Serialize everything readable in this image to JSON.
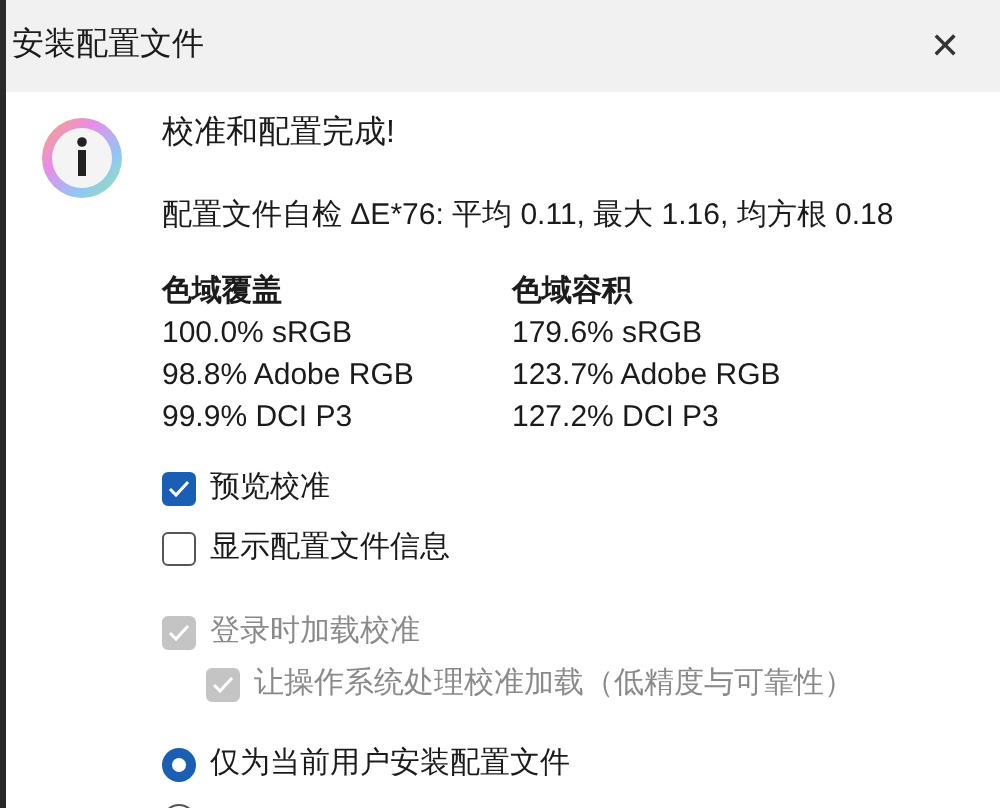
{
  "window": {
    "title": "安装配置文件",
    "close": "✕"
  },
  "heading": "校准和配置完成!",
  "self_check": "配置文件自检 ΔE*76: 平均 0.11, 最大 1.16, 均方根 0.18",
  "gamut_columns": [
    {
      "title": "色域覆盖",
      "rows": [
        "100.0% sRGB",
        "98.8% Adobe RGB",
        "99.9% DCI P3"
      ]
    },
    {
      "title": "色域容积",
      "rows": [
        "179.6% sRGB",
        "123.7% Adobe RGB",
        "127.2% DCI P3"
      ]
    }
  ],
  "checkboxes": [
    {
      "label": "预览校准",
      "checked": true,
      "disabled": false
    },
    {
      "label": "显示配置文件信息",
      "checked": false,
      "disabled": false
    }
  ],
  "login_options": [
    {
      "label": "登录时加载校准",
      "checked": true,
      "disabled": true,
      "children": [
        {
          "label": "让操作系统处理校准加载（低精度与可靠性）",
          "checked": true,
          "disabled": true
        }
      ]
    }
  ],
  "install_scope": [
    {
      "label": "仅为当前用户安装配置文件",
      "selected": true
    },
    {
      "selected": false
    }
  ]
}
